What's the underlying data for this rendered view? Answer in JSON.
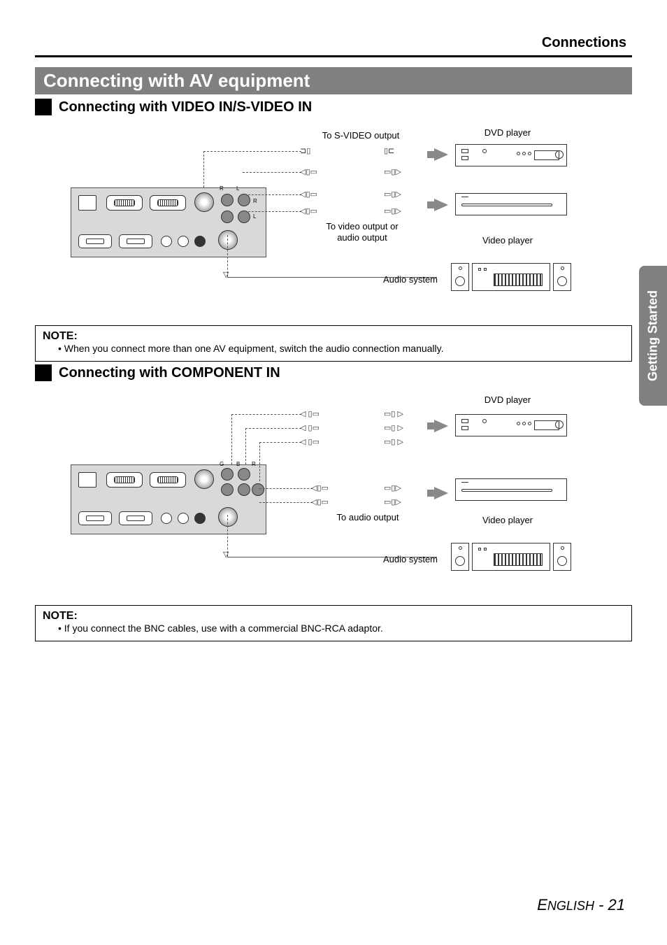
{
  "header": {
    "section": "Connections"
  },
  "title": "Connecting with AV equipment",
  "sub1": "Connecting with VIDEO IN/S-VIDEO IN",
  "sub2": "Connecting with COMPONENT IN",
  "diagram1": {
    "svideo_label": "To S-VIDEO output",
    "video_audio_label": "To video output or audio output",
    "dvd_label": "DVD player",
    "video_player_label": "Video player",
    "audio_system_label": "Audio system"
  },
  "diagram2": {
    "dvd_label": "DVD player",
    "audio_out_label": "To audio output",
    "video_player_label": "Video player",
    "audio_system_label": "Audio system"
  },
  "note1": {
    "title": "NOTE:",
    "bullet": "When you connect more than one AV equipment, switch the audio connection manually."
  },
  "note2": {
    "title": "NOTE:",
    "bullet": "If you connect the BNC cables, use with a commercial BNC-RCA adaptor."
  },
  "sidetab": "Getting Started",
  "footer": {
    "lang_initial": "E",
    "lang_rest": "NGLISH",
    "sep": " - ",
    "page": "21"
  },
  "ports": {
    "letters": [
      "R",
      "L",
      "R",
      "L",
      "G",
      "B",
      "R"
    ]
  }
}
